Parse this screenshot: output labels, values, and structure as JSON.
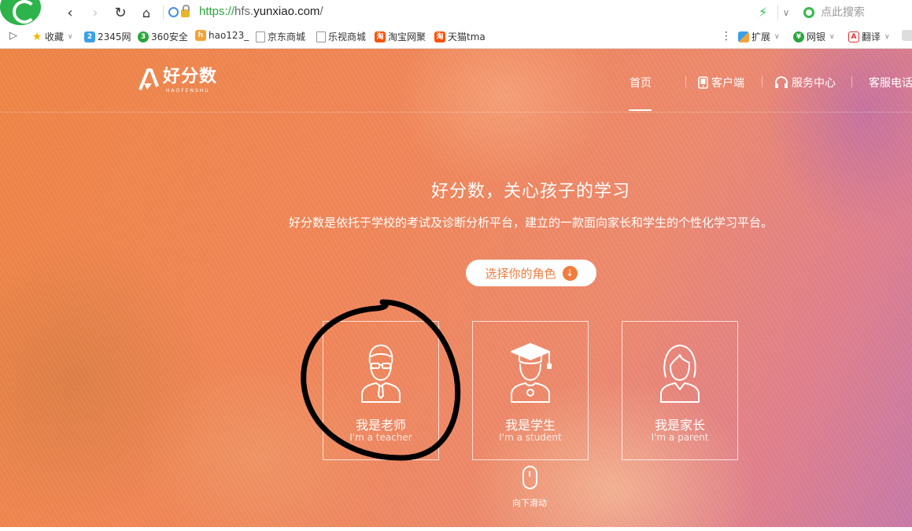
{
  "browser": {
    "url": {
      "protocol": "https://",
      "subdomain": "hfs.",
      "domain": "yunxiao.com",
      "path": "/"
    },
    "search_placeholder": "点此搜索",
    "nav_icons": [
      "back-icon",
      "forward-icon",
      "reload-icon",
      "home-icon"
    ]
  },
  "bookmarks": {
    "left": [
      {
        "label": "收藏",
        "icon": "star-icon",
        "dropdown": true
      },
      {
        "label": "2345网",
        "icon": "2345-icon"
      },
      {
        "label": "360安全",
        "icon": "360-icon"
      },
      {
        "label": "hao123_",
        "icon": "hao123-icon"
      },
      {
        "label": "京东商城",
        "icon": "page-icon"
      },
      {
        "label": "乐视商城",
        "icon": "page-icon"
      },
      {
        "label": "淘宝网聚",
        "icon": "taobao-icon"
      },
      {
        "label": "天猫tma",
        "icon": "tmall-icon"
      }
    ],
    "right": [
      {
        "label": "扩展",
        "icon": "extensions-icon"
      },
      {
        "label": "网银",
        "icon": "bank-icon"
      },
      {
        "label": "翻译",
        "icon": "translate-icon"
      }
    ]
  },
  "site": {
    "logo_name": "好分数",
    "logo_sub": "HAOFENSHU",
    "nav": {
      "home": "首页",
      "client": "客户端",
      "service": "服务中心",
      "phone": "客服电话"
    },
    "hero": {
      "title": "好分数，关心孩子的学习",
      "subtitle": "好分数是依托于学校的考试及诊断分析平台，建立的一款面向家长和学生的个性化学习平台。",
      "role_button": "选择你的角色"
    },
    "roles": [
      {
        "title": "我是老师",
        "subtitle": "I'm a teacher",
        "icon": "teacher-icon"
      },
      {
        "title": "我是学生",
        "subtitle": "I'm a student",
        "icon": "student-icon"
      },
      {
        "title": "我是家长",
        "subtitle": "I'm a parent",
        "icon": "parent-icon"
      }
    ],
    "scroll_hint": "向下滑动"
  },
  "colors": {
    "accent": "#f07c3e",
    "url_green": "#2aa53c",
    "annotation": "#000000"
  }
}
